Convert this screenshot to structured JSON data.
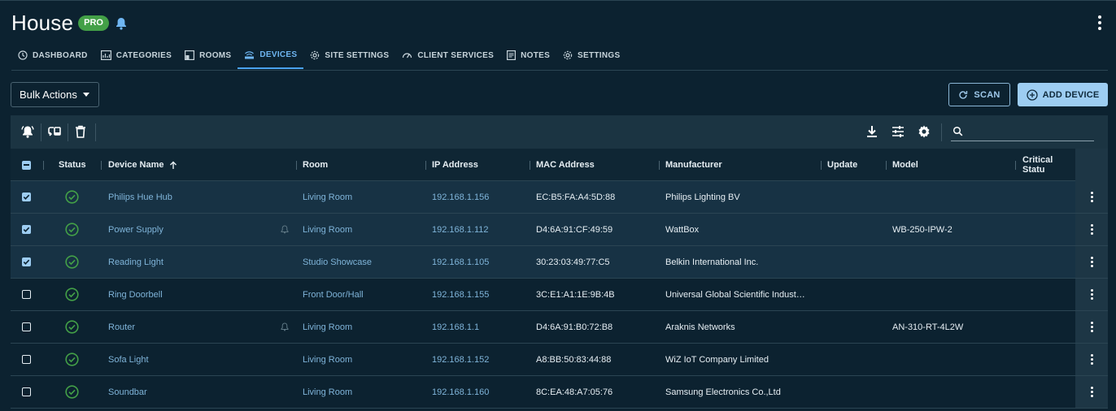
{
  "app": {
    "title": "House",
    "badge": "PRO"
  },
  "tabs": [
    {
      "label": "DASHBOARD",
      "icon": "clock-icon"
    },
    {
      "label": "CATEGORIES",
      "icon": "chart-icon"
    },
    {
      "label": "ROOMS",
      "icon": "room-icon"
    },
    {
      "label": "DEVICES",
      "icon": "router-icon",
      "active": true
    },
    {
      "label": "SITE SETTINGS",
      "icon": "gear-icon"
    },
    {
      "label": "CLIENT SERVICES",
      "icon": "speedometer-icon"
    },
    {
      "label": "NOTES",
      "icon": "notes-icon"
    },
    {
      "label": "SETTINGS",
      "icon": "gear-icon"
    }
  ],
  "actions": {
    "bulk_label": "Bulk Actions",
    "scan_label": "SCAN",
    "add_label": "ADD DEVICE"
  },
  "search": {
    "placeholder": ""
  },
  "columns": {
    "status": "Status",
    "device_name": "Device Name",
    "room": "Room",
    "ip": "IP Address",
    "mac": "MAC Address",
    "manufacturer": "Manufacturer",
    "update": "Update",
    "model": "Model",
    "critical": "Critical Statu"
  },
  "rows": [
    {
      "selected": true,
      "name": "Philips Hue Hub",
      "muted": false,
      "room": "Living Room",
      "ip": "192.168.1.156",
      "mac": "EC:B5:FA:A4:5D:88",
      "manufacturer": "Philips Lighting BV",
      "model": ""
    },
    {
      "selected": true,
      "name": "Power Supply",
      "muted": true,
      "room": "Living Room",
      "ip": "192.168.1.112",
      "mac": "D4:6A:91:CF:49:59",
      "manufacturer": "WattBox",
      "model": "WB-250-IPW-2"
    },
    {
      "selected": true,
      "name": "Reading Light",
      "muted": false,
      "room": "Studio Showcase",
      "ip": "192.168.1.105",
      "mac": "30:23:03:49:77:C5",
      "manufacturer": "Belkin International Inc.",
      "model": ""
    },
    {
      "selected": false,
      "name": "Ring Doorbell",
      "muted": false,
      "room": "Front Door/Hall",
      "ip": "192.168.1.155",
      "mac": "3C:E1:A1:1E:9B:4B",
      "manufacturer": "Universal Global Scientific Indust…",
      "model": ""
    },
    {
      "selected": false,
      "name": "Router",
      "muted": true,
      "room": "Living Room",
      "ip": "192.168.1.1",
      "mac": "D4:6A:91:B0:72:B8",
      "manufacturer": "Araknis Networks",
      "model": "AN-310-RT-4L2W"
    },
    {
      "selected": false,
      "name": "Sofa Light",
      "muted": false,
      "room": "Living Room",
      "ip": "192.168.1.152",
      "mac": "A8:BB:50:83:44:88",
      "manufacturer": "WiZ IoT Company Limited",
      "model": ""
    },
    {
      "selected": false,
      "name": "Soundbar",
      "muted": false,
      "room": "Living Room",
      "ip": "192.168.1.160",
      "mac": "8C:EA:48:A7:05:76",
      "manufacturer": "Samsung Electronics Co.,Ltd",
      "model": ""
    }
  ],
  "colors": {
    "accent": "#6fb6f2",
    "ok": "#43a047",
    "background": "#0c2230"
  }
}
